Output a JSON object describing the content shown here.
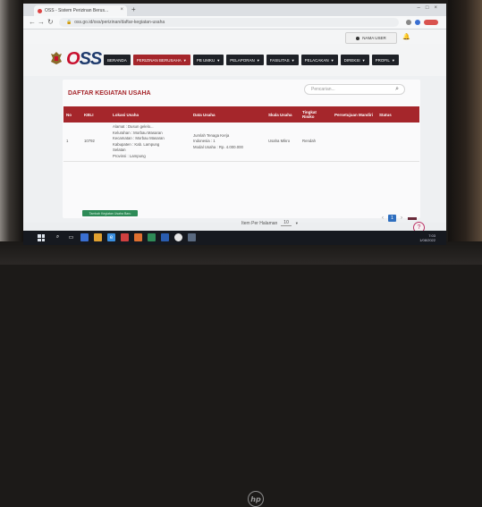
{
  "browser": {
    "tab_title": "OSS - Sistem Perizinan Berus...",
    "url": "oss.go.id/oss/perizinan/daftar-kegiatan-usaha"
  },
  "topbar": {
    "user_label": "NAMA USER"
  },
  "logo": {
    "text_o": "O",
    "text_ss": "SS"
  },
  "menu": [
    {
      "label": "BERANDA",
      "dropdown": false,
      "active": false
    },
    {
      "label": "PERIZINAN BERUSAHA",
      "dropdown": true,
      "active": true
    },
    {
      "label": "PB UMKU",
      "dropdown": true,
      "active": false
    },
    {
      "label": "PELAPORAN",
      "dropdown": true,
      "active": false
    },
    {
      "label": "FASILITAS",
      "dropdown": true,
      "active": false
    },
    {
      "label": "PELACAKAN",
      "dropdown": true,
      "active": false
    },
    {
      "label": "DIREKSI",
      "dropdown": true,
      "active": false
    },
    {
      "label": "PROFIL",
      "dropdown": true,
      "active": false
    }
  ],
  "page_title": "DAFTAR KEGIATAN USAHA",
  "search": {
    "placeholder": "Pencarian..."
  },
  "table": {
    "headers": [
      "No",
      "KBLI",
      "Lokasi Usaha",
      "Data Usaha",
      "Skala Usaha",
      "Tingkat Risiko",
      "Persetujuan Mandiri",
      "Status"
    ],
    "rows": [
      {
        "no": "1",
        "kbli": "10792",
        "lokasi": [
          "Alamat : Dusun gelelo...",
          "Kelurahan : Morbau Masaran",
          "Kecamatan : Morbau Masaran",
          "Kabupaten : Kab. Lampung",
          "Selatan",
          "Provinsi : Lampung"
        ],
        "data_usaha": [
          "Jumlah Tenaga Kerja",
          "Indonesia : 1",
          "Modal Usaha : Rp. 4.000.000"
        ],
        "skala": "Usaha Mikro",
        "risiko": "Rendah",
        "persetujuan": "",
        "status": ""
      }
    ]
  },
  "add_button": "Tambah Kegiatan Usaha Baru",
  "pager": {
    "label": "Item Per Halaman",
    "per_page": "10",
    "current_page": "1"
  },
  "taskbar": {
    "time": "7:03",
    "date": "1/08/2022"
  },
  "colors": {
    "brand_red": "#a5262b",
    "menu_dark": "#1e2127",
    "add_green": "#2e8b57"
  }
}
